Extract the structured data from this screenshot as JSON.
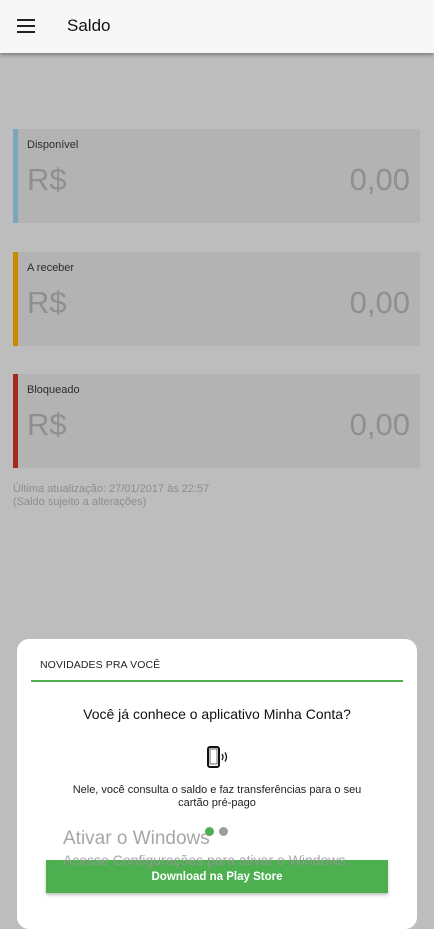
{
  "header": {
    "title": "Saldo",
    "menu_icon": "hamburger-menu-icon"
  },
  "balances": [
    {
      "label": "Disponível",
      "currency": "R$",
      "amount": "0,00",
      "color": "#7aa7bd"
    },
    {
      "label": "A receber",
      "currency": "R$",
      "amount": "0,00",
      "color": "#c98a00"
    },
    {
      "label": "Bloqueado",
      "currency": "R$",
      "amount": "0,00",
      "color": "#a52a1f"
    }
  ],
  "info": {
    "last_update": "Última atualização: 27/01/2017 às 22:57",
    "note": "(Saldo sujeito a alterações)"
  },
  "dialog": {
    "header": "NOVIDADES PRA VOCÊ",
    "question": "Você já conhece o aplicativo Minha Conta?",
    "icon": "phone-vibrate-icon",
    "description": "Nele, você consulta o saldo e faz transferências para o seu cartão pré-pago",
    "page_indicator": {
      "current": 1,
      "total": 2,
      "active_color": "#4caf50",
      "inactive_color": "#9e9e9e"
    },
    "button_label": "Download na Play Store",
    "accent_color": "#4caf50"
  },
  "watermark": {
    "title": "Ativar o Windows",
    "subtitle": "Acesse Configurações para ativar o Windows."
  }
}
